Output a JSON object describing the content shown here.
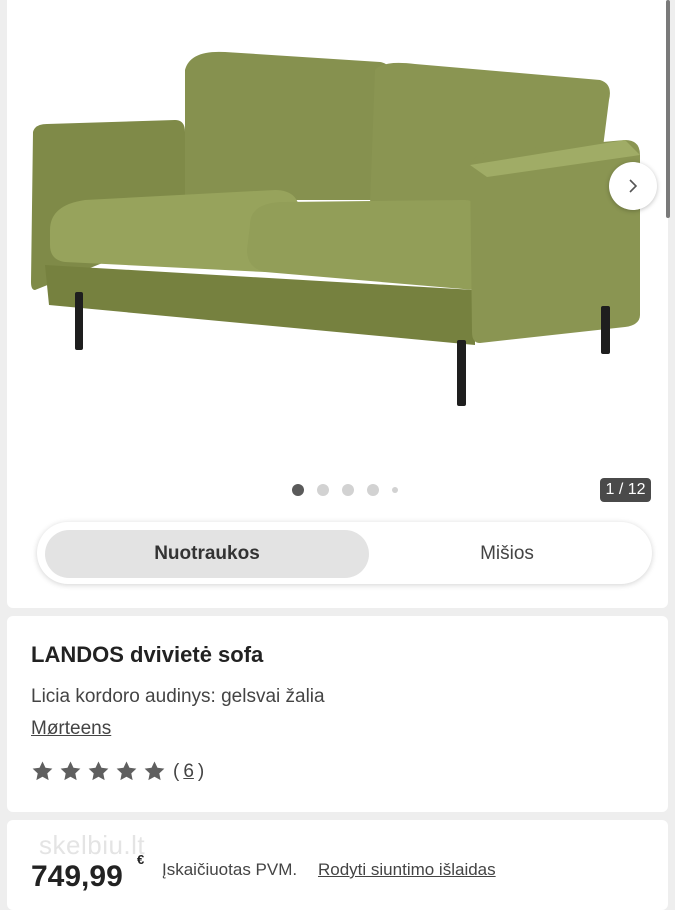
{
  "gallery": {
    "image_alt": "LANDOS dvivietė sofa",
    "counter": "1 / 12",
    "dots_total": 5,
    "active_dot": 0,
    "tabs": [
      {
        "label": "Nuotraukos",
        "active": true
      },
      {
        "label": "Mišios",
        "active": false
      }
    ]
  },
  "product": {
    "title": "LANDOS dvivietė sofa",
    "subtitle": "Licia kordoro audinys: gelsvai žalia",
    "brand": "Mørteens",
    "rating_stars": 5,
    "review_open": "(",
    "review_count": "6",
    "review_close": ")"
  },
  "pricing": {
    "watermark": "skelbiu.lt",
    "price": "749,99",
    "currency": "€",
    "vat_note": "Įskaičiuotas PVM.",
    "shipping_link": "Rodyti siuntimo išlaidas"
  },
  "colors": {
    "sofa": "#8b9653",
    "sofa_dark": "#6f7a3f",
    "legs": "#1e1e1e",
    "star": "#5f5f5f"
  }
}
